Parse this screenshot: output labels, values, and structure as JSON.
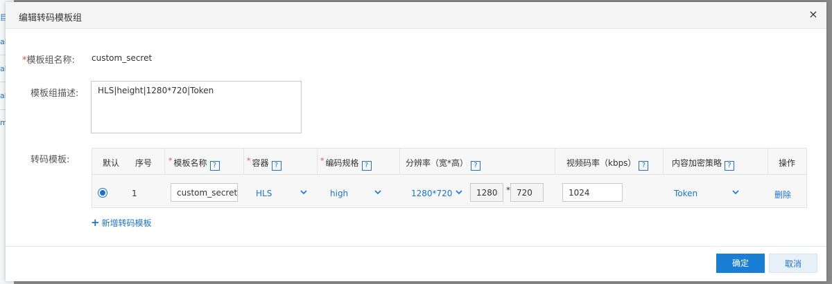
{
  "dialog": {
    "title": "编辑转码模板组",
    "close_symbol": "×"
  },
  "background_page": {
    "link_fragments": [
      "目",
      "ab",
      "ab",
      "ab",
      "m"
    ]
  },
  "form": {
    "required_mark": "*",
    "group_name_label": "模板组名称:",
    "group_name_value": "custom_secret",
    "group_desc_label": "模板组描述:",
    "group_desc_value": "HLS|height|1280*720|Token",
    "templates_label": "转码模板:"
  },
  "table": {
    "headers": {
      "default": "默认",
      "index": "序号",
      "name": "模板名称",
      "container": "容器",
      "codec": "编码规格",
      "resolution": "分辨率（宽*高）",
      "bitrate": "视频码率（kbps）",
      "encryption": "内容加密策略",
      "action": "操作"
    },
    "help_symbol": "?",
    "rows": [
      {
        "selected": true,
        "index": "1",
        "name": "custom_secret",
        "container": "HLS",
        "codec": "high",
        "resolution_preset": "1280*720",
        "width": "1280",
        "times": "*",
        "height": "720",
        "bitrate": "1024",
        "encryption": "Token",
        "delete_label": "删除"
      }
    ]
  },
  "add_template_label": "新增转码模板",
  "add_symbol": "+",
  "footer": {
    "ok_label": "确定",
    "cancel_label": "取消"
  },
  "colors": {
    "accent": "#1a73c8",
    "primary_button": "#1a7fd4",
    "required": "#e64a3c"
  },
  "icons": {
    "dropdown": "chevron-down-icon",
    "help": "help-icon",
    "close": "close-icon",
    "add": "plus-icon"
  }
}
